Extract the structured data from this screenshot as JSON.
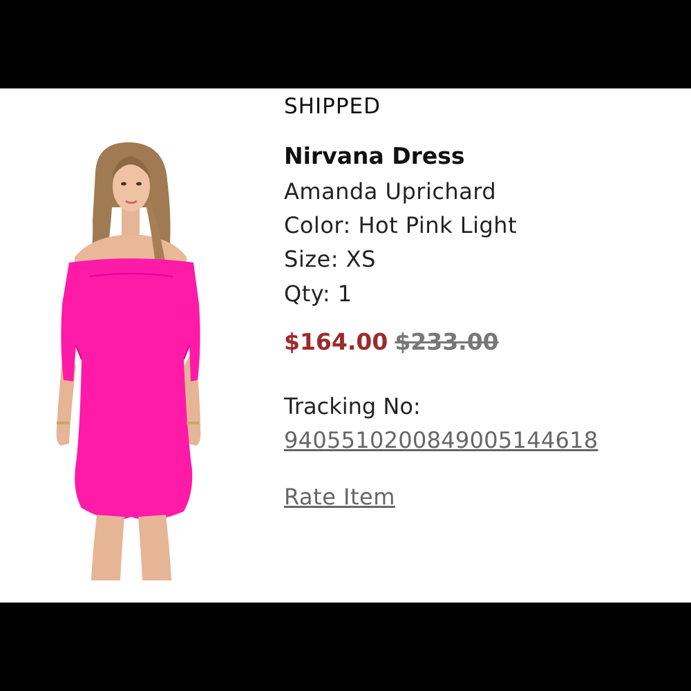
{
  "order_item": {
    "status": "SHIPPED",
    "product_name": "Nirvana Dress",
    "brand": "Amanda Uprichard",
    "color_line": "Color: Hot Pink Light",
    "size_line": "Size: XS",
    "qty_line": "Qty: 1",
    "sale_price": "$164.00",
    "original_price": "$233.00",
    "tracking_label": "Tracking No:",
    "tracking_number": "9405510200849005144618",
    "rate_item_label": "Rate Item"
  },
  "colors": {
    "sale_price": "#9e2a2b",
    "original_price": "#777777",
    "dress": "#ff1aa8",
    "link": "#666666"
  },
  "icons": {
    "product_image": "model-in-hot-pink-off-shoulder-dress"
  }
}
